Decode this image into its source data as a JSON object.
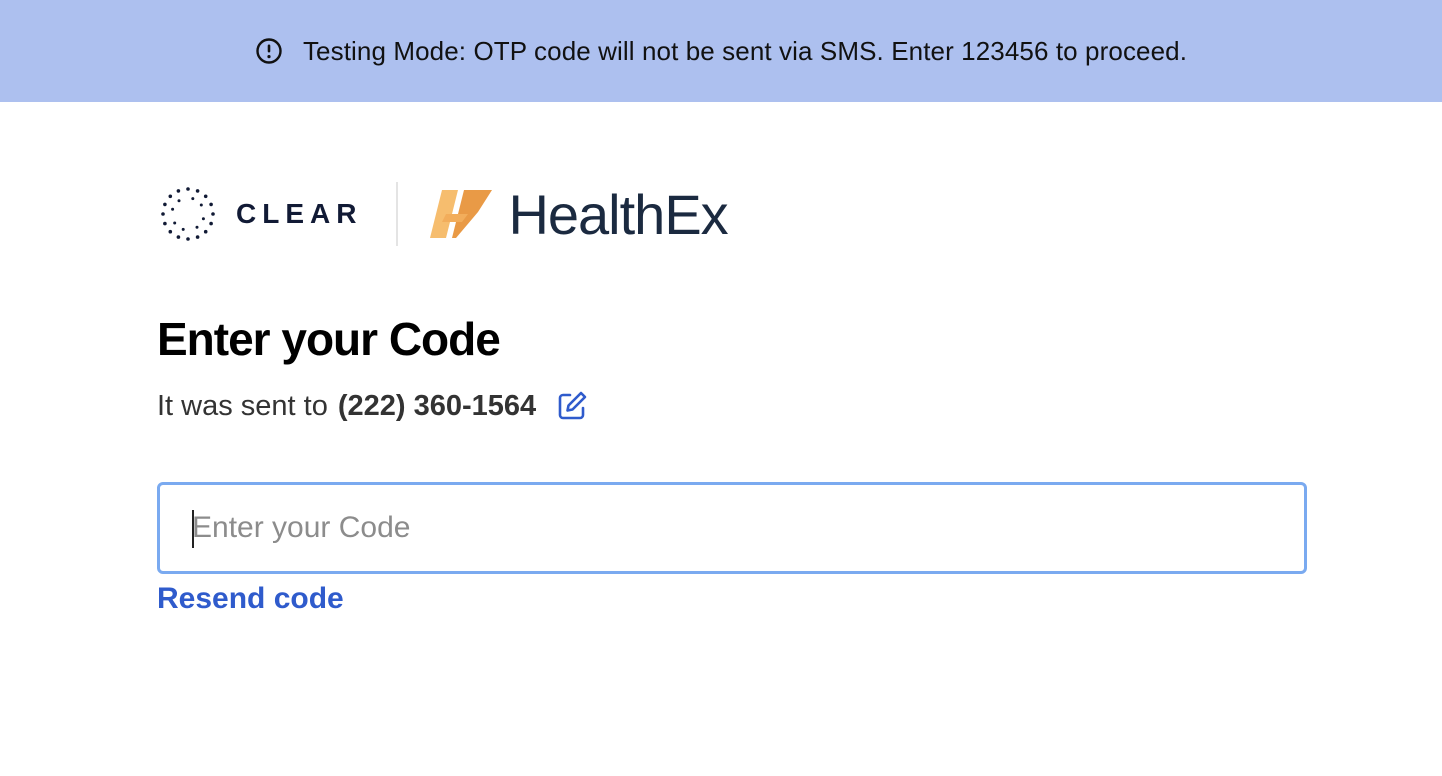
{
  "banner": {
    "icon": "alert-circle-icon",
    "text": "Testing Mode: OTP code will not be sent via SMS. Enter 123456 to proceed.",
    "background": "#adc0ef"
  },
  "logos": {
    "clear": {
      "icon": "clear-dots-logo-icon",
      "wordmark": "CLEAR"
    },
    "healthex": {
      "icon": "healthex-mark-icon",
      "wordmark": "HealthEx",
      "accent": "#f0a04b"
    }
  },
  "main": {
    "title": "Enter your Code",
    "sent_prefix": "It was sent to",
    "phone": "(222) 360-1564",
    "edit_icon": "edit-pencil-icon",
    "code_input": {
      "placeholder": "Enter your Code",
      "value": ""
    },
    "resend_label": "Resend code",
    "link_color": "#2f5bcc"
  }
}
